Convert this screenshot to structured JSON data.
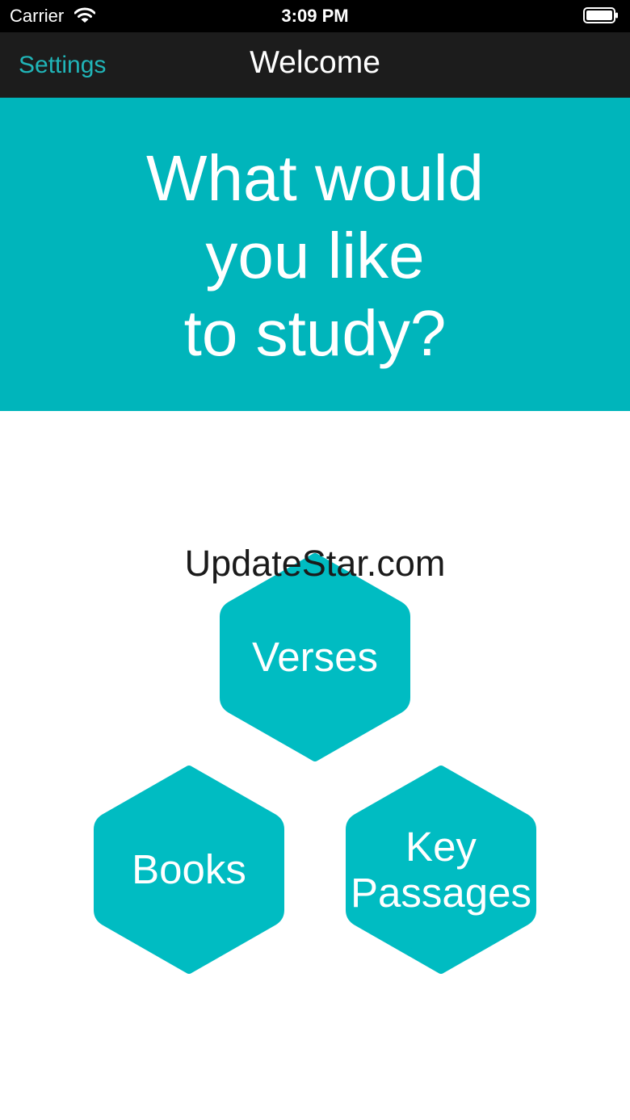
{
  "status_bar": {
    "carrier": "Carrier",
    "time": "3:09 PM",
    "wifi_icon": "wifi-icon",
    "battery_icon": "battery-icon"
  },
  "nav": {
    "settings_label": "Settings",
    "title": "Welcome"
  },
  "banner": {
    "lines": [
      "What would",
      "you like",
      "to study?"
    ]
  },
  "watermark": "UpdateStar.com",
  "options": {
    "verses": "Verses",
    "books": "Books",
    "key_line1": "Key",
    "key_line2": "Passages"
  },
  "colors": {
    "accent": "#00b5bb",
    "nav_bg": "#1c1c1c",
    "settings_text": "#20b5b8"
  }
}
